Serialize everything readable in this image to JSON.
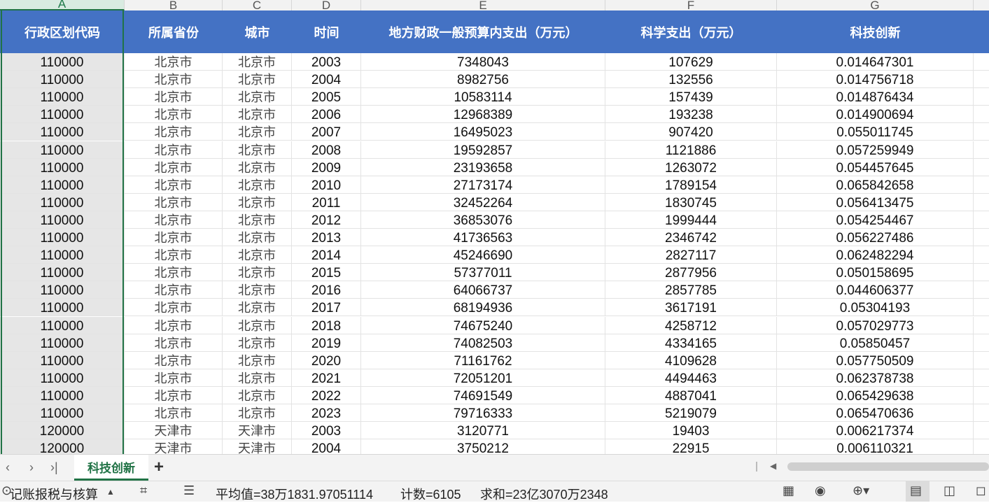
{
  "column_letters": [
    "A",
    "B",
    "C",
    "D",
    "E",
    "F",
    "G"
  ],
  "headers": [
    "行政区划代码",
    "所属省份",
    "城市",
    "时间",
    "地方财政一般预算内支出（万元）",
    "科学支出（万元）",
    "科技创新"
  ],
  "rows": [
    [
      "110000",
      "北京市",
      "北京市",
      "2003",
      "7348043",
      "107629",
      "0.014647301"
    ],
    [
      "110000",
      "北京市",
      "北京市",
      "2004",
      "8982756",
      "132556",
      "0.014756718"
    ],
    [
      "110000",
      "北京市",
      "北京市",
      "2005",
      "10583114",
      "157439",
      "0.014876434"
    ],
    [
      "110000",
      "北京市",
      "北京市",
      "2006",
      "12968389",
      "193238",
      "0.014900694"
    ],
    [
      "110000",
      "北京市",
      "北京市",
      "2007",
      "16495023",
      "907420",
      "0.055011745"
    ],
    [
      "110000",
      "北京市",
      "北京市",
      "2008",
      "19592857",
      "1121886",
      "0.057259949"
    ],
    [
      "110000",
      "北京市",
      "北京市",
      "2009",
      "23193658",
      "1263072",
      "0.054457645"
    ],
    [
      "110000",
      "北京市",
      "北京市",
      "2010",
      "27173174",
      "1789154",
      "0.065842658"
    ],
    [
      "110000",
      "北京市",
      "北京市",
      "2011",
      "32452264",
      "1830745",
      "0.056413475"
    ],
    [
      "110000",
      "北京市",
      "北京市",
      "2012",
      "36853076",
      "1999444",
      "0.054254467"
    ],
    [
      "110000",
      "北京市",
      "北京市",
      "2013",
      "41736563",
      "2346742",
      "0.056227486"
    ],
    [
      "110000",
      "北京市",
      "北京市",
      "2014",
      "45246690",
      "2827117",
      "0.062482294"
    ],
    [
      "110000",
      "北京市",
      "北京市",
      "2015",
      "57377011",
      "2877956",
      "0.050158695"
    ],
    [
      "110000",
      "北京市",
      "北京市",
      "2016",
      "64066737",
      "2857785",
      "0.044606377"
    ],
    [
      "110000",
      "北京市",
      "北京市",
      "2017",
      "68194936",
      "3617191",
      "0.05304193"
    ],
    [
      "110000",
      "北京市",
      "北京市",
      "2018",
      "74675240",
      "4258712",
      "0.057029773"
    ],
    [
      "110000",
      "北京市",
      "北京市",
      "2019",
      "74082503",
      "4334165",
      "0.05850457"
    ],
    [
      "110000",
      "北京市",
      "北京市",
      "2020",
      "71161762",
      "4109628",
      "0.057750509"
    ],
    [
      "110000",
      "北京市",
      "北京市",
      "2021",
      "72051201",
      "4494463",
      "0.062378738"
    ],
    [
      "110000",
      "北京市",
      "北京市",
      "2022",
      "74691549",
      "4887041",
      "0.065429638"
    ],
    [
      "110000",
      "北京市",
      "北京市",
      "2023",
      "79716333",
      "5219079",
      "0.065470636"
    ],
    [
      "120000",
      "天津市",
      "天津市",
      "2003",
      "3120771",
      "19403",
      "0.006217374"
    ],
    [
      "120000",
      "天津市",
      "天津市",
      "2004",
      "3750212",
      "22915",
      "0.006110321"
    ]
  ],
  "sheet_tabs": [
    {
      "label": "科技创新",
      "active": true
    }
  ],
  "tabbar": {
    "nav_prev": "‹",
    "nav_next": "›",
    "nav_last": "›|",
    "add_tab": "+"
  },
  "statusbar": {
    "app_label": "记账报税与核算",
    "average": "平均值=38万1831.97051114",
    "count": "计数=6105",
    "sum": "求和=23亿3070万2348"
  },
  "colors": {
    "header_bg": "#4472c4",
    "selection": "#217346",
    "active_tab_text": "#217346"
  }
}
